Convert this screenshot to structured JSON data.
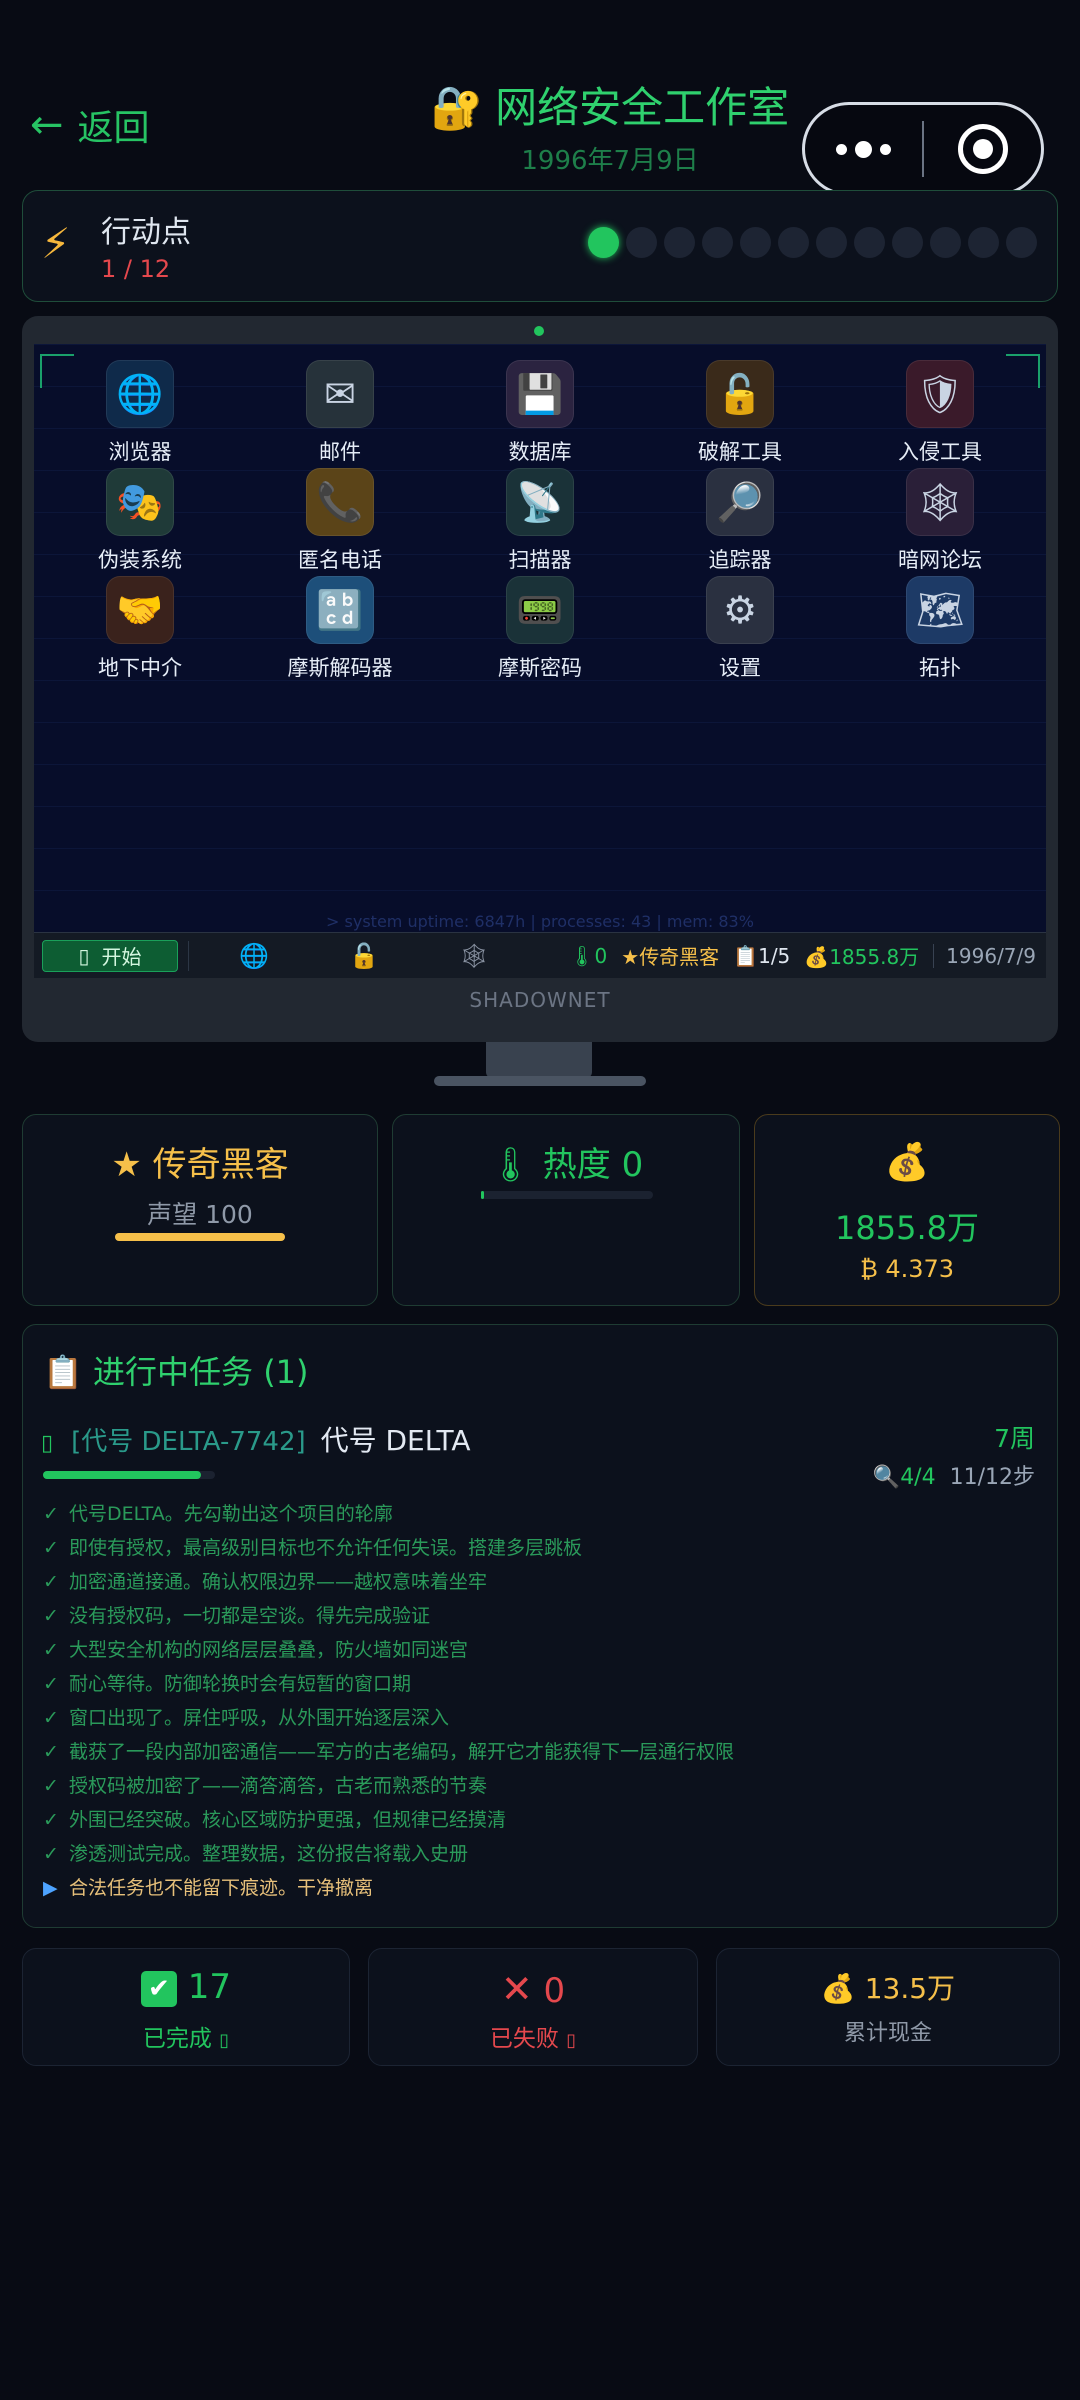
{
  "header": {
    "back_label": "返回",
    "title": "网络安全工作室",
    "date": "1996年7月9日"
  },
  "action_points": {
    "label": "行动点",
    "value": "1 / 12",
    "current": 1,
    "max": 12
  },
  "desktop": {
    "icons": [
      {
        "label": "浏览器",
        "icon": "globe-icon",
        "glyph": "🌐",
        "bg": "#0f2a4a"
      },
      {
        "label": "邮件",
        "icon": "mail-icon",
        "glyph": "✉",
        "bg": "#26323a"
      },
      {
        "label": "数据库",
        "icon": "floppy-disk-icon",
        "glyph": "💾",
        "bg": "#2b2340"
      },
      {
        "label": "破解工具",
        "icon": "unlock-icon",
        "glyph": "🔓",
        "bg": "#3a2a1a"
      },
      {
        "label": "入侵工具",
        "icon": "shield-icon",
        "glyph": "🛡",
        "bg": "#3a1a2a"
      },
      {
        "label": "伪装系统",
        "icon": "masks-icon",
        "glyph": "🎭",
        "bg": "#1f3a38"
      },
      {
        "label": "匿名电话",
        "icon": "phone-icon",
        "glyph": "📞",
        "bg": "#5b4418"
      },
      {
        "label": "扫描器",
        "icon": "satellite-icon",
        "glyph": "📡",
        "bg": "#1a3238"
      },
      {
        "label": "追踪器",
        "icon": "magnifier-icon",
        "glyph": "🔎",
        "bg": "#2a3040"
      },
      {
        "label": "暗网论坛",
        "icon": "spiderweb-icon",
        "glyph": "🕸",
        "bg": "#2a1f38"
      },
      {
        "label": "地下中介",
        "icon": "handshake-icon",
        "glyph": "🤝",
        "bg": "#3a221c"
      },
      {
        "label": "摩斯解码器",
        "icon": "abcd-icon",
        "glyph": "🔡",
        "bg": "#1d4f7a"
      },
      {
        "label": "摩斯密码",
        "icon": "pager-icon",
        "glyph": "📟",
        "bg": "#1a3238"
      },
      {
        "label": "设置",
        "icon": "gear-icon",
        "glyph": "⚙",
        "bg": "#2a3040"
      },
      {
        "label": "拓扑",
        "icon": "map-icon",
        "glyph": "🗺",
        "bg": "#1d3a66"
      }
    ],
    "uptime": "> system uptime: 6847h | processes: 43 | mem: 83%",
    "taskbar": {
      "start_label": "开始",
      "heat_value": "0",
      "rank": "传奇黑客",
      "tasks": "1/5",
      "cash": "1855.8万",
      "date": "1996/7/9"
    },
    "brand": "SHADOWNET"
  },
  "stats": {
    "rank_title": "传奇黑客",
    "reputation_label": "声望 100",
    "reputation_fill": 1.0,
    "heat_title": "热度 0",
    "heat_fill": 0.0,
    "cash_value": "1855.8万",
    "btc_value": "₿ 4.373"
  },
  "mission": {
    "section_title": "进行中任务 (1)",
    "code": "[代号 DELTA-7742]",
    "name": "代号 DELTA",
    "weeks": "7周",
    "clues": "4/4",
    "steps_progress": "11/12步",
    "progress_fill": 0.92,
    "steps": [
      "代号DELTA。先勾勒出这个项目的轮廓",
      "即使有授权，最高级别目标也不允许任何失误。搭建多层跳板",
      "加密通道接通。确认权限边界——越权意味着坐牢",
      "没有授权码，一切都是空谈。得先完成验证",
      "大型安全机构的网络层层叠叠，防火墙如同迷宫",
      "耐心等待。防御轮换时会有短暂的窗口期",
      "窗口出现了。屏住呼吸，从外围开始逐层深入",
      "截获了一段内部加密通信——军方的古老编码，解开它才能获得下一层通行权限",
      "授权码被加密了——滴答滴答，古老而熟悉的节奏",
      "外围已经突破。核心区域防护更强，但规律已经摸清",
      "渗透测试完成。整理数据，这份报告将载入史册"
    ],
    "current_step": "合法任务也不能留下痕迹。干净撤离"
  },
  "summary": {
    "completed_count": "17",
    "completed_label": "已完成",
    "failed_count": "0",
    "failed_label": "已失败",
    "total_cash": "13.5万",
    "total_cash_label": "累计现金"
  },
  "colors": {
    "accent": "#22c55e",
    "gold": "#f6c04a",
    "danger": "#e5484d",
    "background": "#080b14"
  }
}
